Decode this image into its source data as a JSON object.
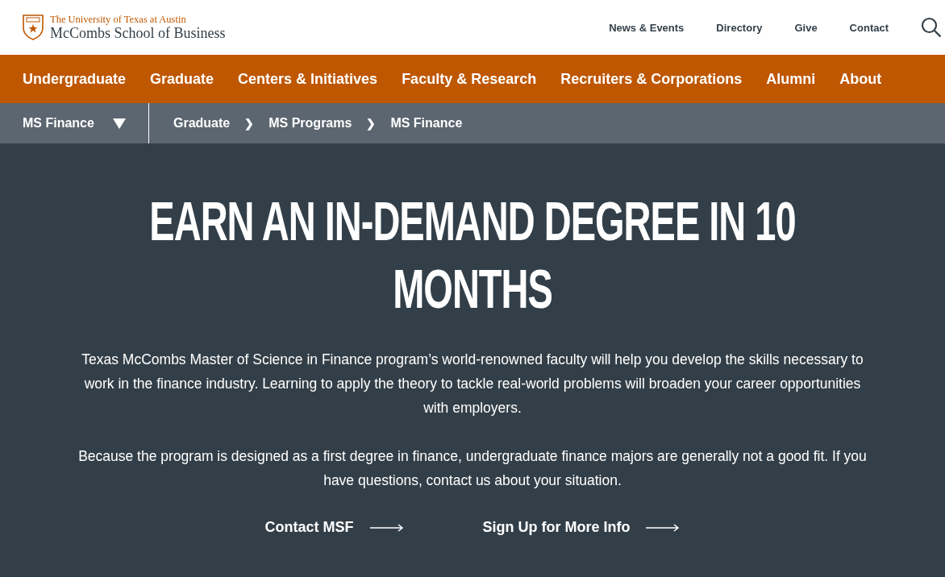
{
  "logo": {
    "university": "The University of Texas at Austin",
    "school": "McCombs School of Business"
  },
  "utility_nav": [
    "News & Events",
    "Directory",
    "Give",
    "Contact"
  ],
  "main_nav": [
    "Undergraduate",
    "Graduate",
    "Centers & Initiatives",
    "Faculty & Research",
    "Recruiters & Corporations",
    "Alumni",
    "About"
  ],
  "section_menu": {
    "label": "MS Finance"
  },
  "breadcrumbs": [
    "Graduate",
    "MS Programs",
    "MS Finance"
  ],
  "breadcrumb_separator": "❯",
  "hero": {
    "headline": "EARN AN IN-DEMAND DEGREE IN 10 MONTHS",
    "paragraphs": [
      "Texas McCombs Master of Science in Finance program’s world-renowned faculty will help you develop the skills necessary to work in the finance industry. Learning to apply the theory to tackle real-world problems will broaden your career opportunities with employers.",
      "Because the program is designed as a first degree in finance, undergraduate finance majors are generally not a good fit. If you have questions, contact us about your situation."
    ],
    "links": [
      "Contact MSF",
      "Sign Up for More Info"
    ]
  }
}
